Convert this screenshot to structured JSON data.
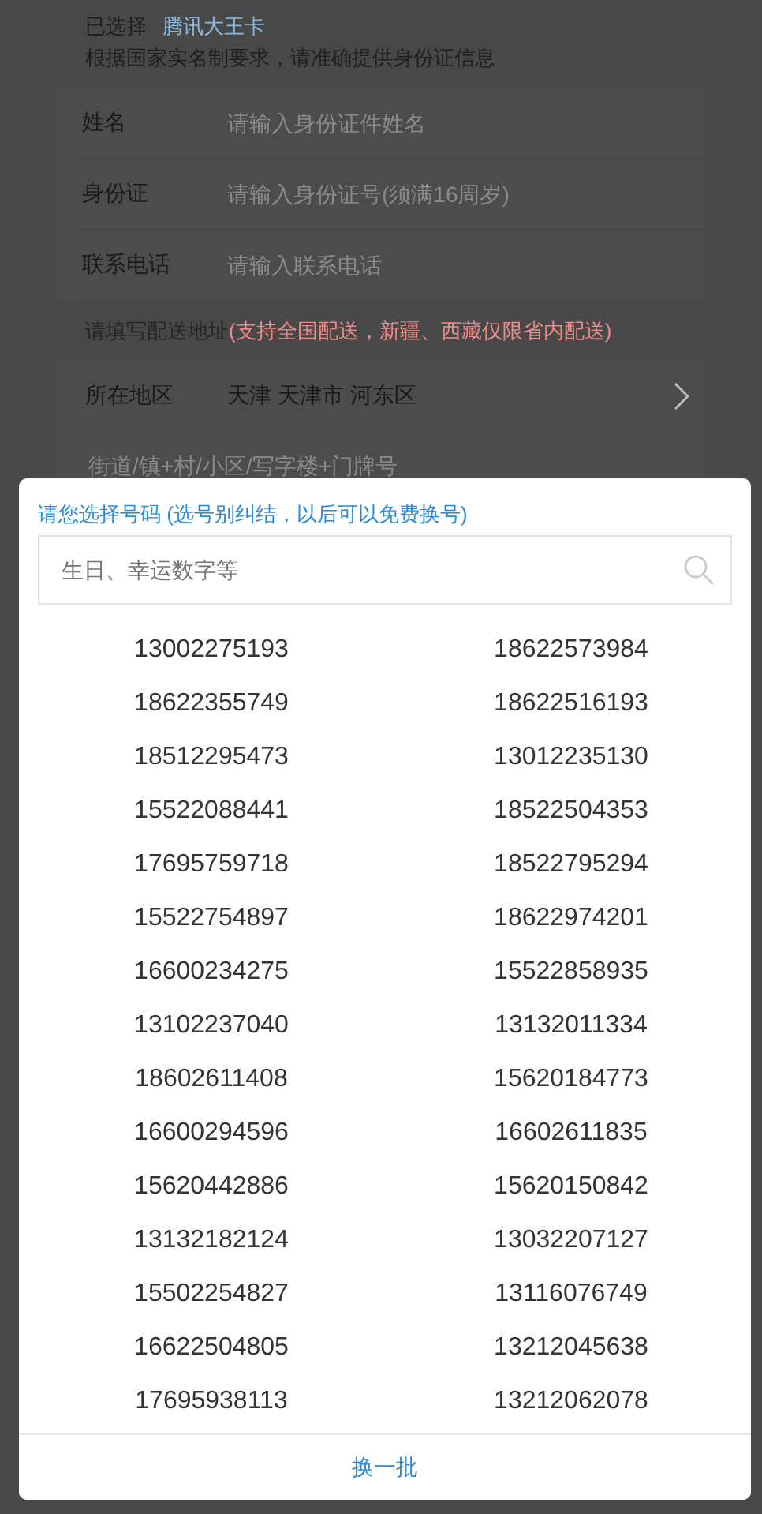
{
  "selection": {
    "label": "已选择",
    "card": "腾讯大王卡",
    "notice": "根据国家实名制要求，请准确提供身份证信息"
  },
  "fields": [
    {
      "label": "姓名",
      "placeholder": "请输入身份证件姓名"
    },
    {
      "label": "身份证",
      "placeholder": "请输入身份证号(须满16周岁)"
    },
    {
      "label": "联系电话",
      "placeholder": "请输入联系电话"
    }
  ],
  "delivery": {
    "prompt": "请填写配送地址",
    "note": "(支持全国配送，新疆、西藏仅限省内配送)"
  },
  "region": {
    "label": "所在地区",
    "value": "天津 天津市 河东区"
  },
  "street": {
    "placeholder": "街道/镇+村/小区/写字楼+门牌号"
  },
  "picker": {
    "title": "请您选择号码 (选号别纠结，以后可以免费换号)",
    "search_placeholder": "生日、幸运数字等",
    "numbers": [
      [
        "13002275193",
        "18622573984"
      ],
      [
        "18622355749",
        "18622516193"
      ],
      [
        "18512295473",
        "13012235130"
      ],
      [
        "15522088441",
        "18522504353"
      ],
      [
        "17695759718",
        "18522795294"
      ],
      [
        "15522754897",
        "18622974201"
      ],
      [
        "16600234275",
        "15522858935"
      ],
      [
        "13102237040",
        "13132011334"
      ],
      [
        "18602611408",
        "15620184773"
      ],
      [
        "16600294596",
        "16602611835"
      ],
      [
        "15620442886",
        "15620150842"
      ],
      [
        "13132182124",
        "13032207127"
      ],
      [
        "15502254827",
        "13116076749"
      ],
      [
        "16622504805",
        "13212045638"
      ],
      [
        "17695938113",
        "13212062078"
      ]
    ],
    "refresh": "换一批"
  }
}
